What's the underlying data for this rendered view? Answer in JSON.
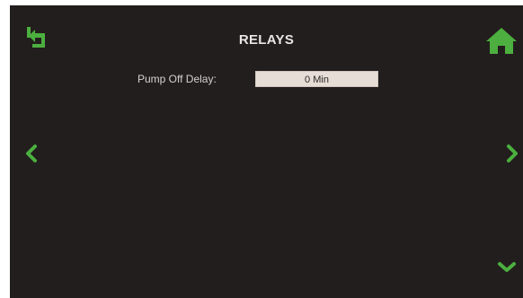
{
  "header": {
    "title": "RELAYS"
  },
  "fields": {
    "pump_off_delay": {
      "label": "Pump Off Delay:",
      "value": "0 Min"
    }
  },
  "icons": {
    "back": "back-arrow-icon",
    "home": "home-icon",
    "prev": "chevron-left-icon",
    "next": "chevron-right-icon",
    "down": "chevron-down-icon"
  },
  "colors": {
    "background": "#221e1d",
    "accent": "#4caf3f",
    "text": "#e8e6e3",
    "field_bg": "#e6ded6"
  }
}
